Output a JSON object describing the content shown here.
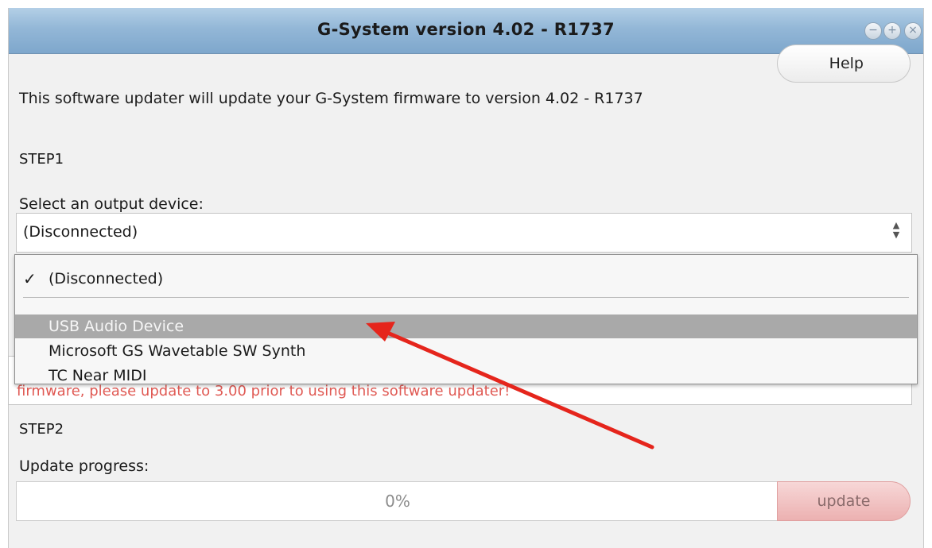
{
  "window": {
    "title": "G-System version 4.02 - R1737",
    "controls": {
      "minimize": "−",
      "maximize": "+",
      "close": "×"
    }
  },
  "help_button": {
    "label": "Help"
  },
  "intro_text": "This software updater will update your G-System firmware to version 4.02 - R1737",
  "step1": {
    "heading": "STEP1",
    "select_label": "Select an output device:",
    "selected_value": "(Disconnected)",
    "options": [
      {
        "label": "(Disconnected)",
        "checked": true
      },
      {
        "label": "USB Audio Device",
        "highlighted": true
      },
      {
        "label": "Microsoft GS Wavetable SW Synth"
      },
      {
        "label": "TC Near MIDI"
      }
    ],
    "warning_partial": "firmware, please update to 3.00 prior to using this software updater!"
  },
  "step2": {
    "heading": "STEP2",
    "progress_label": "Update progress:",
    "progress_value": "0%",
    "update_label": "update"
  },
  "colors": {
    "titlebar": "#93b7d7",
    "warning": "#e05a54",
    "highlight": "#a9a9a9",
    "arrow": "#e5251c",
    "update_button": "#ecb1b1"
  }
}
